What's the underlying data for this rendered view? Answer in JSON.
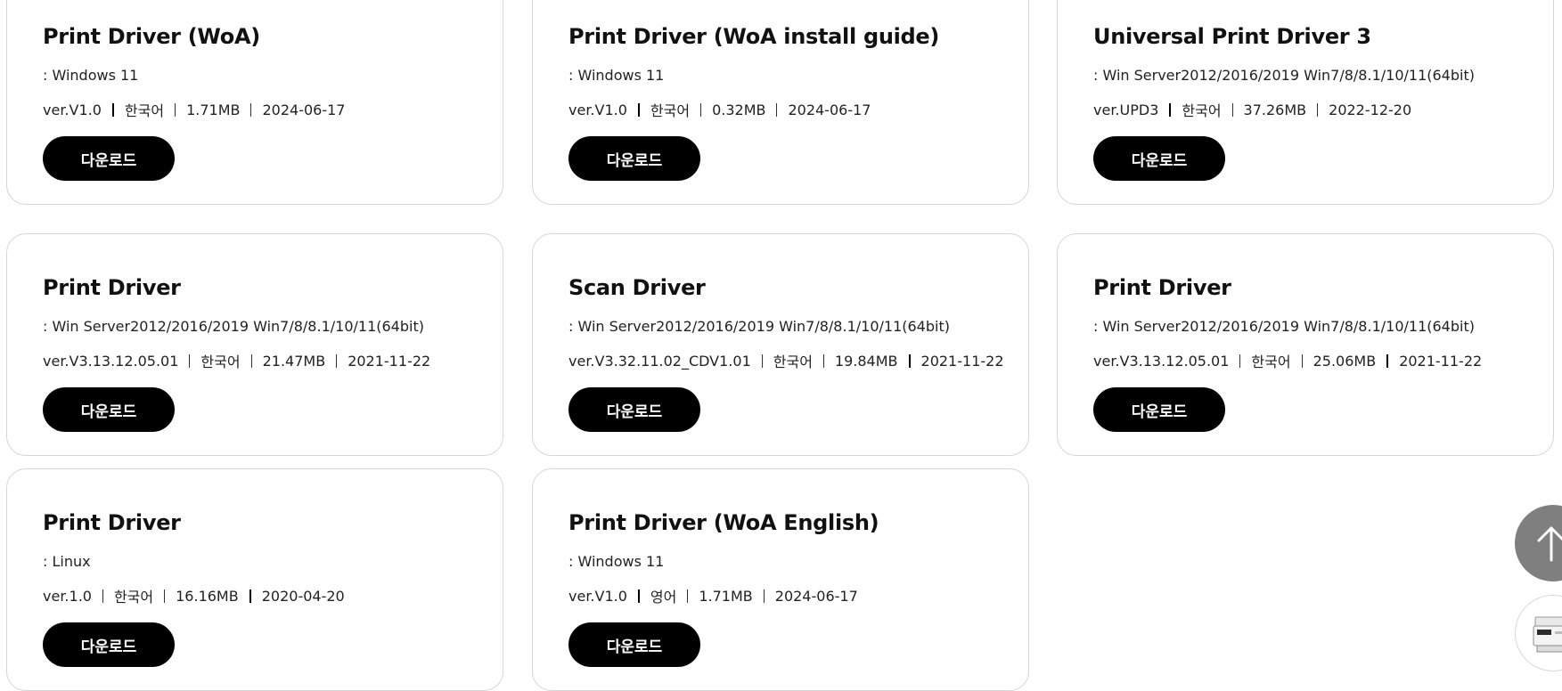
{
  "download_label": "다운로드",
  "cards": [
    {
      "title": "Print Driver (WoA)",
      "os": ": Windows 11",
      "version": "ver.V1.0",
      "language": "한국어",
      "size": "1.71MB",
      "date": "2024-06-17"
    },
    {
      "title": "Print Driver (WoA install guide)",
      "os": ": Windows 11",
      "version": "ver.V1.0",
      "language": "한국어",
      "size": "0.32MB",
      "date": "2024-06-17"
    },
    {
      "title": "Universal Print Driver 3",
      "os": ": Win Server2012/2016/2019 Win7/8/8.1/10/11(64bit)",
      "version": "ver.UPD3",
      "language": "한국어",
      "size": "37.26MB",
      "date": "2022-12-20"
    },
    {
      "title": "Print Driver",
      "os": ": Win Server2012/2016/2019 Win7/8/8.1/10/11(64bit)",
      "version": "ver.V3.13.12.05.01",
      "language": "한국어",
      "size": "21.47MB",
      "date": "2021-11-22"
    },
    {
      "title": "Scan Driver",
      "os": ": Win Server2012/2016/2019 Win7/8/8.1/10/11(64bit)",
      "version": "ver.V3.32.11.02_CDV1.01",
      "language": "한국어",
      "size": "19.84MB",
      "date": "2021-11-22"
    },
    {
      "title": "Print Driver",
      "os": ": Win Server2012/2016/2019 Win7/8/8.1/10/11(64bit)",
      "version": "ver.V3.13.12.05.01",
      "language": "한국어",
      "size": "25.06MB",
      "date": "2021-11-22"
    },
    {
      "title": "Print Driver",
      "os": ": Linux",
      "version": "ver.1.0",
      "language": "한국어",
      "size": "16.16MB",
      "date": "2020-04-20"
    },
    {
      "title": "Print Driver (WoA English)",
      "os": ": Windows 11",
      "version": "ver.V1.0",
      "language": "영어",
      "size": "1.71MB",
      "date": "2024-06-17"
    }
  ],
  "floating": {
    "scroll_top_icon": "arrow-up-icon",
    "product_icon": "printer-thumbnail"
  }
}
